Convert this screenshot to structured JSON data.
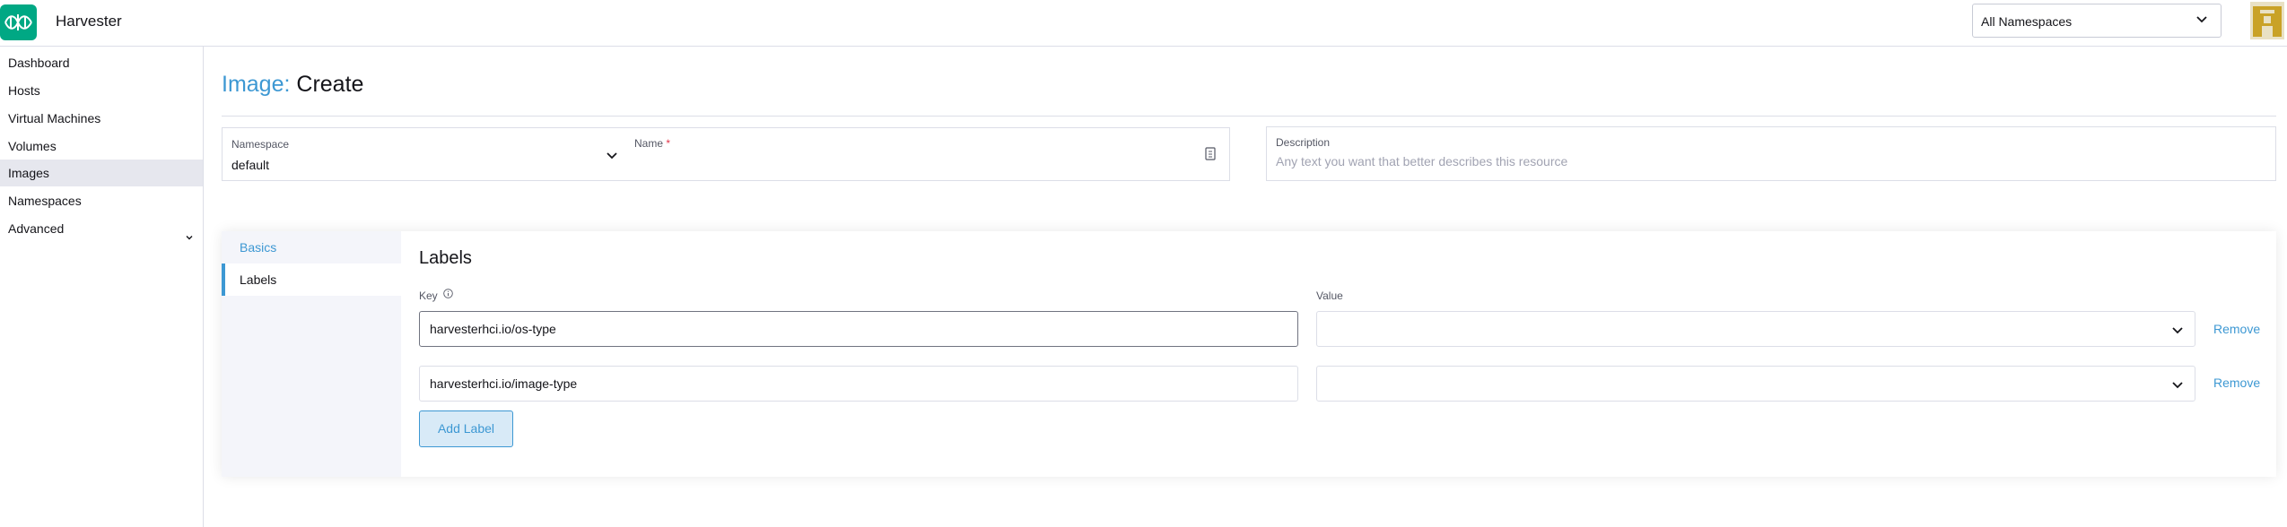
{
  "header": {
    "app_title": "Harvester",
    "namespace_select": "All Namespaces",
    "icons": {
      "logo": "harvester-logo-icon",
      "chevron": "chevron-down-icon",
      "avatar": "user-avatar-icon"
    }
  },
  "sidebar": {
    "items": [
      {
        "label": "Dashboard",
        "active": false
      },
      {
        "label": "Hosts",
        "active": false
      },
      {
        "label": "Virtual Machines",
        "active": false
      },
      {
        "label": "Volumes",
        "active": false
      },
      {
        "label": "Images",
        "active": true
      },
      {
        "label": "Namespaces",
        "active": false
      },
      {
        "label": "Advanced",
        "active": false,
        "expandable": true
      }
    ]
  },
  "page": {
    "crumb": "Image:",
    "action": "Create"
  },
  "form": {
    "namespace": {
      "label": "Namespace",
      "value": "default"
    },
    "name": {
      "label": "Name",
      "required_mark": "*",
      "value": ""
    },
    "description": {
      "label": "Description",
      "placeholder": "Any text you want that better describes this resource"
    }
  },
  "tabs": [
    {
      "label": "Basics",
      "active": false
    },
    {
      "label": "Labels",
      "active": true
    }
  ],
  "labels_section": {
    "title": "Labels",
    "key_header": "Key",
    "value_header": "Value",
    "rows": [
      {
        "key": "harvesterhci.io/os-type",
        "value": "",
        "remove": "Remove"
      },
      {
        "key": "harvesterhci.io/image-type",
        "value": "",
        "remove": "Remove"
      }
    ],
    "add_button": "Add Label"
  },
  "colors": {
    "accent": "#3d98d3",
    "logo": "#00a884",
    "active_nav": "#e6e7ee",
    "required": "#e2354a"
  }
}
